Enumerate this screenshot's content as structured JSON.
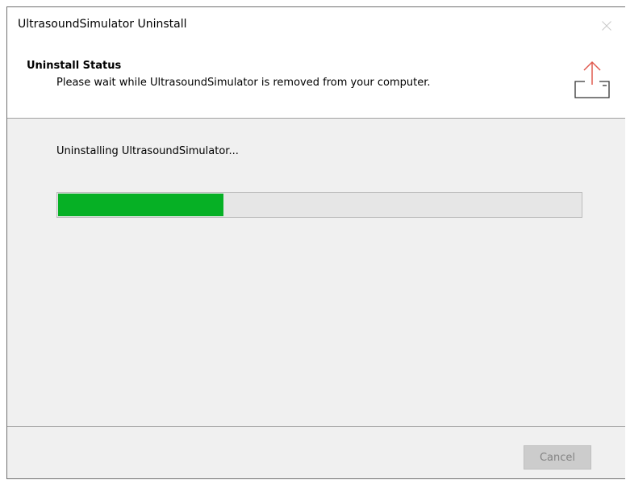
{
  "window": {
    "title": "UltrasoundSimulator Uninstall",
    "close_icon": "close-icon"
  },
  "header": {
    "title": "Uninstall Status",
    "subtitle": "Please wait while UltrasoundSimulator is removed from your computer.",
    "icon": "uninstall-upload-icon",
    "icon_color": "#e05a4f"
  },
  "body": {
    "status_text": "Uninstalling UltrasoundSimulator...",
    "progress_percent": 31.5,
    "progress_color": "#06b025"
  },
  "footer": {
    "cancel_label": "Cancel",
    "cancel_enabled": false
  }
}
